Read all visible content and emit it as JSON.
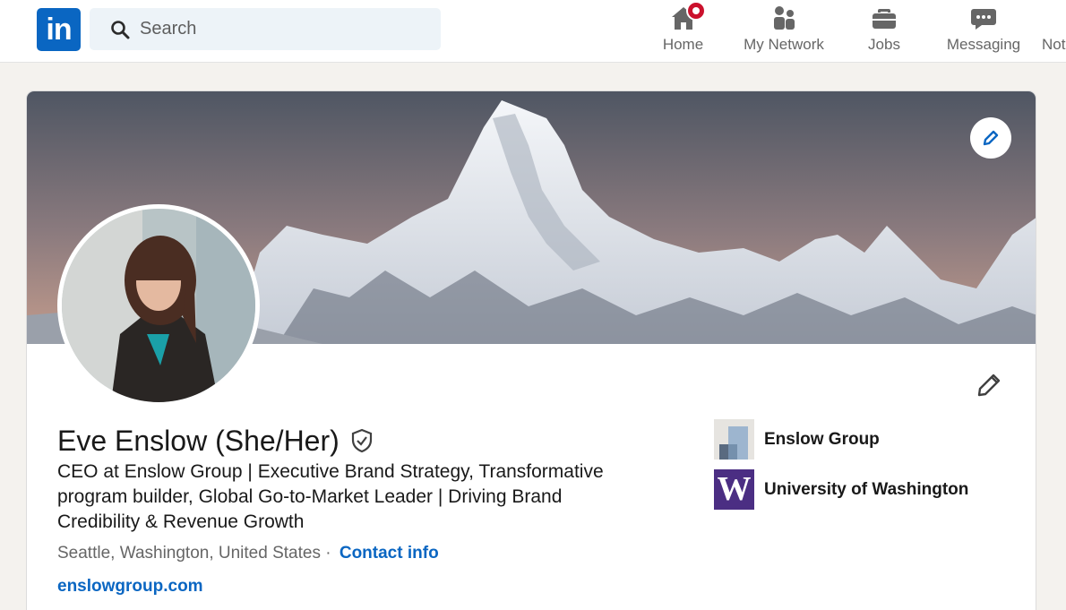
{
  "brand": {
    "logo_text": "in",
    "color": "#0a66c2"
  },
  "search": {
    "placeholder": "Search",
    "value": ""
  },
  "nav": [
    {
      "label": "Home",
      "icon": "home-icon",
      "notification": true
    },
    {
      "label": "My Network",
      "icon": "network-icon"
    },
    {
      "label": "Jobs",
      "icon": "briefcase-icon"
    },
    {
      "label": "Messaging",
      "icon": "messaging-icon"
    },
    {
      "label": "Not",
      "icon": "notifications-icon"
    }
  ],
  "profile": {
    "name": "Eve Enslow (She/Her)",
    "verified": true,
    "headline": "CEO at Enslow Group | Executive Brand Strategy, Transformative program builder, Global Go-to-Market Leader | Driving Brand Credibility & Revenue Growth",
    "location": "Seattle, Washington, United States",
    "separator": " · ",
    "contact_label": "Contact info",
    "website": "enslowgroup.com",
    "affiliations": [
      {
        "name": "Enslow Group",
        "logo": "enslow-group-logo"
      },
      {
        "name": "University of Washington",
        "logo": "uw-logo",
        "logo_text": "W",
        "color": "#4b2e83"
      }
    ]
  },
  "colors": {
    "link": "#0a66c2",
    "badge": "#cb112d",
    "page_bg": "#f4f2ee"
  }
}
